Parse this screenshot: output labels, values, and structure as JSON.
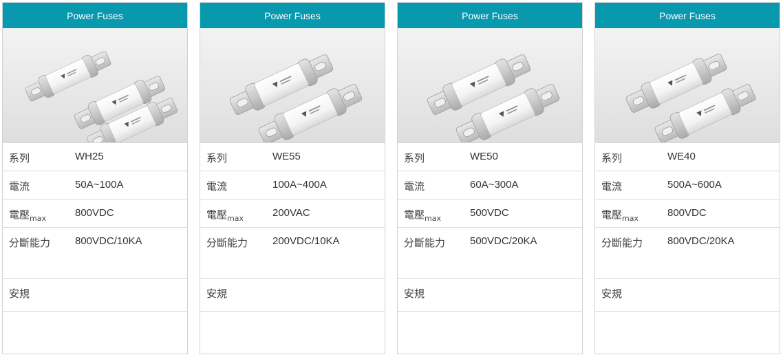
{
  "cards": [
    {
      "header": "Power Fuses",
      "image_alt": "WH25 power fuses with bolt tags",
      "rows": {
        "series": {
          "label": "系列",
          "value": "WH25"
        },
        "current": {
          "label": "電流",
          "value": "50A~100A"
        },
        "voltage": {
          "label": "電壓",
          "sub": "max",
          "value": "800VDC"
        },
        "breaking": {
          "label": "分斷能力",
          "value": "800VDC/10KA"
        },
        "safety": {
          "label": "安規",
          "value": ""
        }
      }
    },
    {
      "header": "Power Fuses",
      "image_alt": "WE55 power fuses",
      "rows": {
        "series": {
          "label": "系列",
          "value": "WE55"
        },
        "current": {
          "label": "電流",
          "value": "100A~400A"
        },
        "voltage": {
          "label": "電壓",
          "sub": "max",
          "value": "200VAC"
        },
        "breaking": {
          "label": "分斷能力",
          "value": "200VDC/10KA"
        },
        "safety": {
          "label": "安規",
          "value": ""
        }
      }
    },
    {
      "header": "Power Fuses",
      "image_alt": "WE50 power fuses",
      "rows": {
        "series": {
          "label": "系列",
          "value": "WE50"
        },
        "current": {
          "label": "電流",
          "value": "60A~300A"
        },
        "voltage": {
          "label": "電壓",
          "sub": "max",
          "value": "500VDC"
        },
        "breaking": {
          "label": "分斷能力",
          "value": "500VDC/20KA"
        },
        "safety": {
          "label": "安規",
          "value": ""
        }
      }
    },
    {
      "header": "Power Fuses",
      "image_alt": "WE40 power fuses",
      "rows": {
        "series": {
          "label": "系列",
          "value": "WE40"
        },
        "current": {
          "label": "電流",
          "value": "500A~600A"
        },
        "voltage": {
          "label": "電壓",
          "sub": "max",
          "value": "800VDC"
        },
        "breaking": {
          "label": "分斷能力",
          "value": "800VDC/20KA"
        },
        "safety": {
          "label": "安規",
          "value": ""
        }
      }
    }
  ],
  "colors": {
    "header_bg": "#0899ae",
    "border": "#d2d2d2"
  },
  "icons": [
    "power-fuse-image"
  ]
}
